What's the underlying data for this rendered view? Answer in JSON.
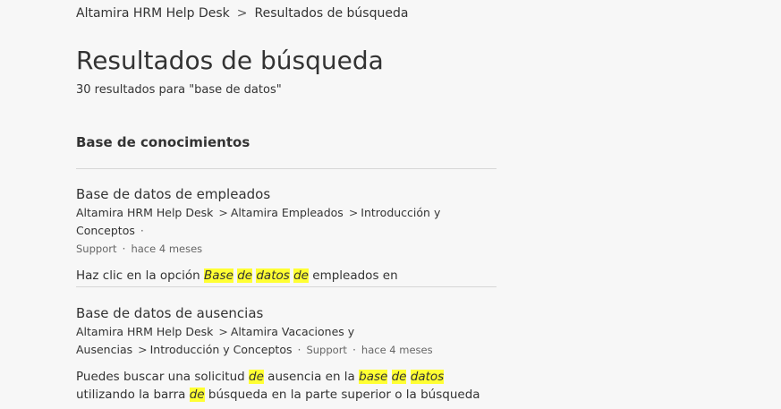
{
  "breadcrumb": {
    "home": "Altamira HRM Help Desk",
    "separator": ">",
    "current": "Resultados de búsqueda"
  },
  "page": {
    "title": "Resultados de búsqueda",
    "result_count": "30 resultados para \"base de datos\""
  },
  "section": {
    "title": "Base de conocimientos"
  },
  "results": [
    {
      "title": "Base de datos de empleados",
      "path": [
        "Altamira HRM Help Desk",
        "Altamira Empleados",
        "Introducción y Conceptos"
      ],
      "author": "Support",
      "time": "hace 4 meses",
      "snippet": [
        {
          "t": "Haz clic en la opción "
        },
        {
          "t": "Base",
          "h": true
        },
        {
          "t": " "
        },
        {
          "t": "de",
          "h": true
        },
        {
          "t": " "
        },
        {
          "t": "datos",
          "h": true
        },
        {
          "t": " "
        },
        {
          "t": "de",
          "h": true
        },
        {
          "t": " empleados en"
        }
      ]
    },
    {
      "title": "Base de datos de ausencias",
      "path": [
        "Altamira HRM Help Desk",
        "Altamira Vacaciones y Ausencias",
        "Introducción y Conceptos"
      ],
      "author": "Support",
      "time": "hace 4 meses",
      "snippet": [
        {
          "t": "Puedes buscar una solicitud "
        },
        {
          "t": "de",
          "h": true
        },
        {
          "t": " ausencia en la "
        },
        {
          "t": "base",
          "h": true
        },
        {
          "t": " "
        },
        {
          "t": "de",
          "h": true
        },
        {
          "t": " "
        },
        {
          "t": "datos",
          "h": true
        },
        {
          "t": " utilizando la barra "
        },
        {
          "t": "de",
          "h": true
        },
        {
          "t": " búsqueda en la parte superior o la búsqueda"
        }
      ]
    }
  ],
  "colors": {
    "background": "#f7f7f7",
    "text": "#333333",
    "highlight": "#ffff33",
    "divider": "#d6d6d6"
  }
}
